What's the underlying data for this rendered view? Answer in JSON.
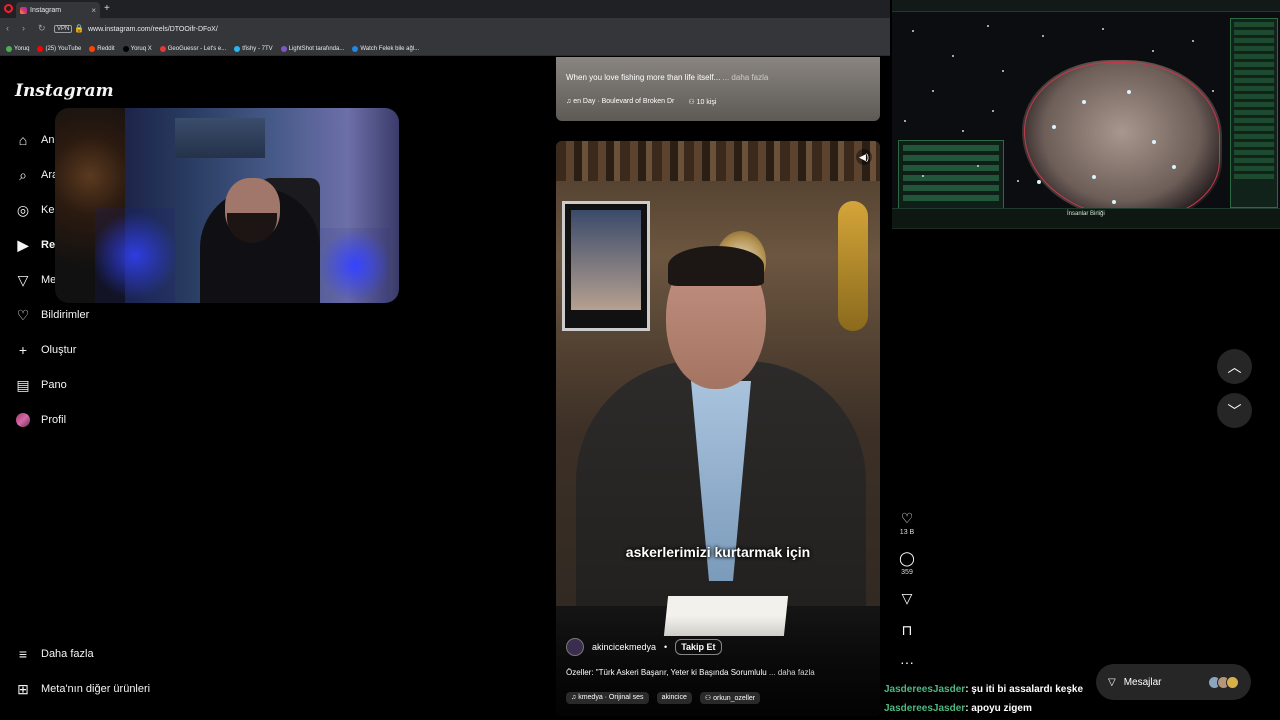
{
  "browser": {
    "tab_title": "Instagram",
    "new_tab": "+",
    "url": "www.instagram.com/reels/DTOOifr-DFoX/",
    "vpn_label": "VPN",
    "bookmarks": [
      {
        "label": "Yoruq",
        "color": "#4caf50"
      },
      {
        "label": "(25) YouTube",
        "color": "#ff0000"
      },
      {
        "label": "Reddit",
        "color": "#ff4500"
      },
      {
        "label": "Yoruq X",
        "color": "#000000"
      },
      {
        "label": "GeoGuessr - Let's e...",
        "color": "#e53935"
      },
      {
        "label": "tfishy - 7TV",
        "color": "#29b6f6"
      },
      {
        "label": "LightShot tarafında...",
        "color": "#7e57c2"
      },
      {
        "label": "Watch Felek bile ağl...",
        "color": "#1e88e5"
      }
    ]
  },
  "sidebar": {
    "logo": "Instagram",
    "items": [
      {
        "label": "An",
        "icon": "home-icon"
      },
      {
        "label": "Ara",
        "icon": "search-icon"
      },
      {
        "label": "Ke",
        "icon": "explore-icon"
      },
      {
        "label": "Re",
        "icon": "reels-icon"
      },
      {
        "label": "Me",
        "icon": "messages-icon"
      },
      {
        "label": "Bildirimler",
        "icon": "heart-icon"
      },
      {
        "label": "Oluştur",
        "icon": "plus-icon"
      },
      {
        "label": "Pano",
        "icon": "dashboard-icon"
      },
      {
        "label": "Profil",
        "icon": "avatar"
      }
    ],
    "more": "Daha fazla",
    "meta": "Meta'nın diğer ürünleri"
  },
  "prev_reel": {
    "caption": "When you love fishing more than life itself...",
    "more": "... daha fazla",
    "audio": "en Day · Boulevard of Broken Dr",
    "people": "10 kişi"
  },
  "reel": {
    "subtitle": "askerlerimizi kurtarmak için",
    "author": "akincicekmedya",
    "follow": "Takip Et",
    "caption": "Özeller: \"Türk Askeri Başarır, Yeter ki Başında Sorumlulu",
    "more": "... daha fazla",
    "audio": "kmedya · Orijinal ses",
    "tag1": "akincice",
    "tag2": "orkun_ozeller"
  },
  "actions": {
    "likes": "13 B",
    "comments": "359"
  },
  "game": {
    "location": "İnsanlar Birliği"
  },
  "chat": [
    {
      "user": "JasdereesJasder",
      "text": ": şu iti bi assalardı keşke"
    },
    {
      "user": "JasdereesJasder",
      "text": ": apoyu zigem"
    }
  ],
  "messages_button": "Mesajlar",
  "colors": {
    "background": "#000000",
    "accent_chat_user": "#4fb882",
    "instagram_button": "#262626"
  }
}
